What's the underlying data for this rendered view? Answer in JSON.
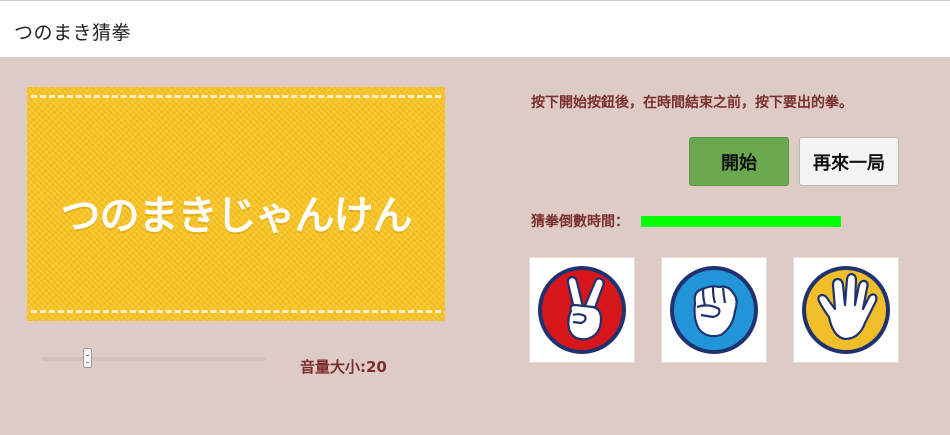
{
  "header": {
    "title": "つのまき猜拳"
  },
  "banner": {
    "text": "つのまきじゃんけん"
  },
  "volume": {
    "label": "音量大小:20",
    "value": 20
  },
  "instruction": "按下開始按鈕後，在時間結束之前，按下要出的拳。",
  "buttons": {
    "start": "開始",
    "again": "再來一局"
  },
  "timer": {
    "label": "猜拳倒數時間：",
    "remaining_fraction": 1.0,
    "color": "#00ff00"
  },
  "choices": [
    {
      "icon": "scissors-hand-icon",
      "color": "#d7161c"
    },
    {
      "icon": "rock-fist-icon",
      "color": "#2295d8"
    },
    {
      "icon": "paper-hand-icon",
      "color": "#f0be28"
    }
  ],
  "colors": {
    "background": "#dfcbc6",
    "text_accent": "#7a2f2f",
    "start_button": "#6aa84f",
    "banner": "#fcc624"
  }
}
